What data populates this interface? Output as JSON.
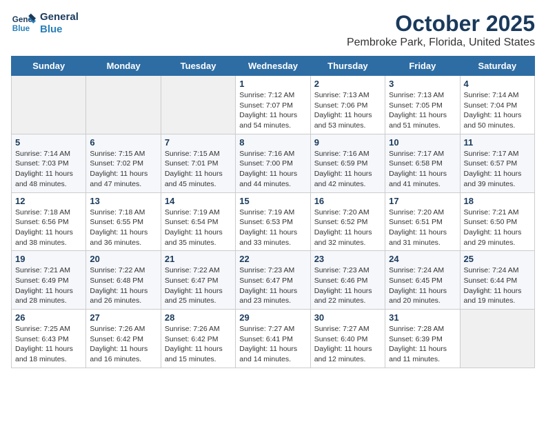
{
  "header": {
    "logo_line1": "General",
    "logo_line2": "Blue",
    "month": "October 2025",
    "location": "Pembroke Park, Florida, United States"
  },
  "days_of_week": [
    "Sunday",
    "Monday",
    "Tuesday",
    "Wednesday",
    "Thursday",
    "Friday",
    "Saturday"
  ],
  "weeks": [
    [
      {
        "day": "",
        "info": ""
      },
      {
        "day": "",
        "info": ""
      },
      {
        "day": "",
        "info": ""
      },
      {
        "day": "1",
        "info": "Sunrise: 7:12 AM\nSunset: 7:07 PM\nDaylight: 11 hours\nand 54 minutes."
      },
      {
        "day": "2",
        "info": "Sunrise: 7:13 AM\nSunset: 7:06 PM\nDaylight: 11 hours\nand 53 minutes."
      },
      {
        "day": "3",
        "info": "Sunrise: 7:13 AM\nSunset: 7:05 PM\nDaylight: 11 hours\nand 51 minutes."
      },
      {
        "day": "4",
        "info": "Sunrise: 7:14 AM\nSunset: 7:04 PM\nDaylight: 11 hours\nand 50 minutes."
      }
    ],
    [
      {
        "day": "5",
        "info": "Sunrise: 7:14 AM\nSunset: 7:03 PM\nDaylight: 11 hours\nand 48 minutes."
      },
      {
        "day": "6",
        "info": "Sunrise: 7:15 AM\nSunset: 7:02 PM\nDaylight: 11 hours\nand 47 minutes."
      },
      {
        "day": "7",
        "info": "Sunrise: 7:15 AM\nSunset: 7:01 PM\nDaylight: 11 hours\nand 45 minutes."
      },
      {
        "day": "8",
        "info": "Sunrise: 7:16 AM\nSunset: 7:00 PM\nDaylight: 11 hours\nand 44 minutes."
      },
      {
        "day": "9",
        "info": "Sunrise: 7:16 AM\nSunset: 6:59 PM\nDaylight: 11 hours\nand 42 minutes."
      },
      {
        "day": "10",
        "info": "Sunrise: 7:17 AM\nSunset: 6:58 PM\nDaylight: 11 hours\nand 41 minutes."
      },
      {
        "day": "11",
        "info": "Sunrise: 7:17 AM\nSunset: 6:57 PM\nDaylight: 11 hours\nand 39 minutes."
      }
    ],
    [
      {
        "day": "12",
        "info": "Sunrise: 7:18 AM\nSunset: 6:56 PM\nDaylight: 11 hours\nand 38 minutes."
      },
      {
        "day": "13",
        "info": "Sunrise: 7:18 AM\nSunset: 6:55 PM\nDaylight: 11 hours\nand 36 minutes."
      },
      {
        "day": "14",
        "info": "Sunrise: 7:19 AM\nSunset: 6:54 PM\nDaylight: 11 hours\nand 35 minutes."
      },
      {
        "day": "15",
        "info": "Sunrise: 7:19 AM\nSunset: 6:53 PM\nDaylight: 11 hours\nand 33 minutes."
      },
      {
        "day": "16",
        "info": "Sunrise: 7:20 AM\nSunset: 6:52 PM\nDaylight: 11 hours\nand 32 minutes."
      },
      {
        "day": "17",
        "info": "Sunrise: 7:20 AM\nSunset: 6:51 PM\nDaylight: 11 hours\nand 31 minutes."
      },
      {
        "day": "18",
        "info": "Sunrise: 7:21 AM\nSunset: 6:50 PM\nDaylight: 11 hours\nand 29 minutes."
      }
    ],
    [
      {
        "day": "19",
        "info": "Sunrise: 7:21 AM\nSunset: 6:49 PM\nDaylight: 11 hours\nand 28 minutes."
      },
      {
        "day": "20",
        "info": "Sunrise: 7:22 AM\nSunset: 6:48 PM\nDaylight: 11 hours\nand 26 minutes."
      },
      {
        "day": "21",
        "info": "Sunrise: 7:22 AM\nSunset: 6:47 PM\nDaylight: 11 hours\nand 25 minutes."
      },
      {
        "day": "22",
        "info": "Sunrise: 7:23 AM\nSunset: 6:47 PM\nDaylight: 11 hours\nand 23 minutes."
      },
      {
        "day": "23",
        "info": "Sunrise: 7:23 AM\nSunset: 6:46 PM\nDaylight: 11 hours\nand 22 minutes."
      },
      {
        "day": "24",
        "info": "Sunrise: 7:24 AM\nSunset: 6:45 PM\nDaylight: 11 hours\nand 20 minutes."
      },
      {
        "day": "25",
        "info": "Sunrise: 7:24 AM\nSunset: 6:44 PM\nDaylight: 11 hours\nand 19 minutes."
      }
    ],
    [
      {
        "day": "26",
        "info": "Sunrise: 7:25 AM\nSunset: 6:43 PM\nDaylight: 11 hours\nand 18 minutes."
      },
      {
        "day": "27",
        "info": "Sunrise: 7:26 AM\nSunset: 6:42 PM\nDaylight: 11 hours\nand 16 minutes."
      },
      {
        "day": "28",
        "info": "Sunrise: 7:26 AM\nSunset: 6:42 PM\nDaylight: 11 hours\nand 15 minutes."
      },
      {
        "day": "29",
        "info": "Sunrise: 7:27 AM\nSunset: 6:41 PM\nDaylight: 11 hours\nand 14 minutes."
      },
      {
        "day": "30",
        "info": "Sunrise: 7:27 AM\nSunset: 6:40 PM\nDaylight: 11 hours\nand 12 minutes."
      },
      {
        "day": "31",
        "info": "Sunrise: 7:28 AM\nSunset: 6:39 PM\nDaylight: 11 hours\nand 11 minutes."
      },
      {
        "day": "",
        "info": ""
      }
    ]
  ]
}
